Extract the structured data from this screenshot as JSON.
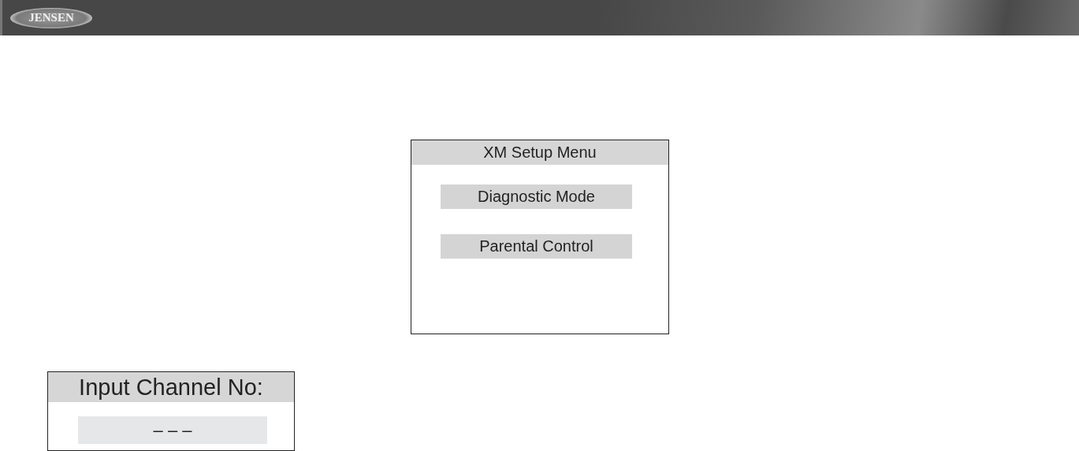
{
  "header": {
    "logo": "JENSEN"
  },
  "setup_menu": {
    "title": "XM Setup Menu",
    "items": [
      "Diagnostic Mode",
      "Parental Control"
    ]
  },
  "channel_input": {
    "title": "Input Channel No:",
    "value": "– – –"
  }
}
